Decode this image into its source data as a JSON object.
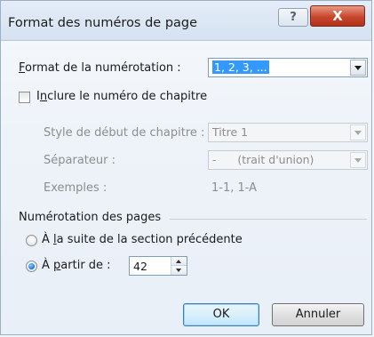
{
  "window": {
    "title": "Format des numéros de page",
    "help_glyph": "?",
    "close_glyph": "X"
  },
  "numbering_format": {
    "label_first": "F",
    "label_rest": "ormat de la numérotation :",
    "value": "1, 2, 3, ..."
  },
  "chapter": {
    "include_prefix": "I",
    "include_underlined": "n",
    "include_rest": "clure le numéro de chapitre",
    "include_checked": false,
    "start_style_label": "Style de début de chapitre :",
    "start_style_value": "Titre 1",
    "separator_label": "Séparateur :",
    "separator_value": "-      (trait d'union)",
    "examples_label": "Exemples :",
    "examples_value": "1-1, 1-A"
  },
  "page_numbering": {
    "section_label": "Numérotation des pages",
    "continue_prefix": "À ",
    "continue_underlined": "l",
    "continue_rest": "a suite de la section précédente",
    "continue_selected": false,
    "start_prefix": "À ",
    "start_underlined": "p",
    "start_rest": "artir de :",
    "start_selected": true,
    "start_value": "42"
  },
  "buttons": {
    "ok": "OK",
    "cancel": "Annuler"
  }
}
